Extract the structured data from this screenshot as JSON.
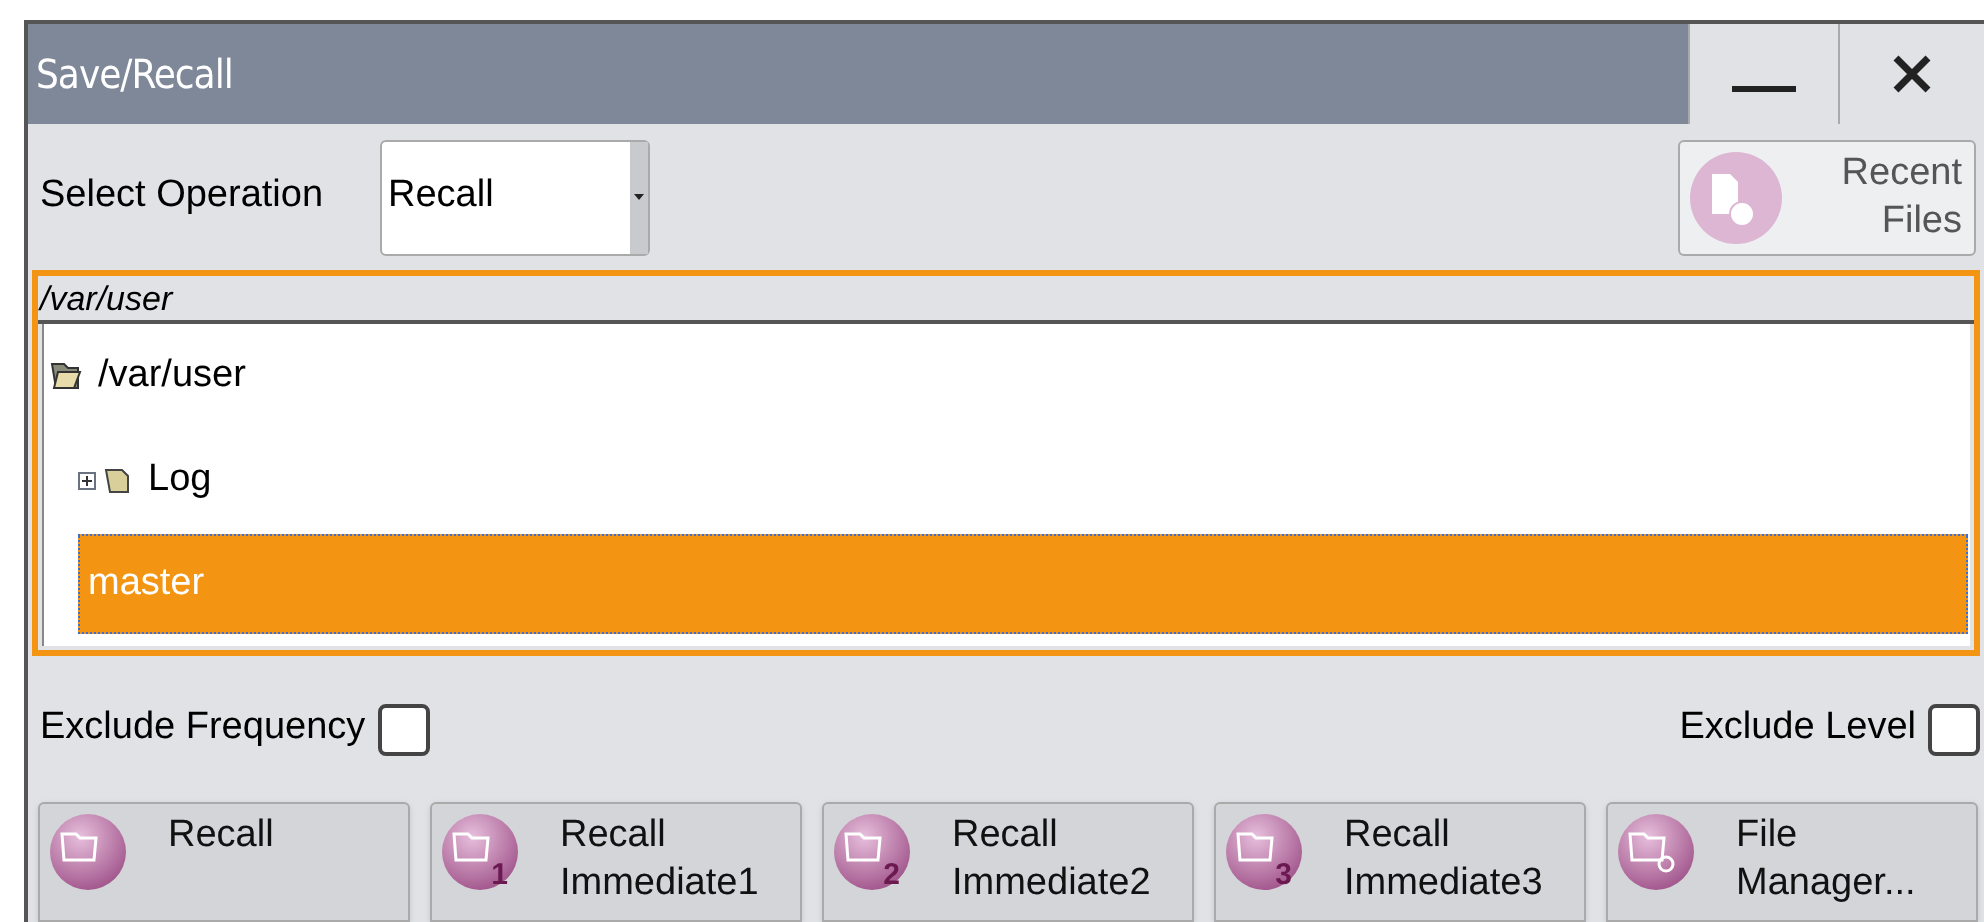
{
  "window": {
    "title": "Save/Recall"
  },
  "operation": {
    "label": "Select Operation",
    "value": "Recall"
  },
  "recent_files": {
    "label": "Recent Files"
  },
  "path_header": "/var/user",
  "tree": [
    {
      "label": "/var/user",
      "kind": "root",
      "selected": false,
      "children": [
        {
          "label": "Log",
          "kind": "folder",
          "expanded": false,
          "selected": false
        },
        {
          "label": "master",
          "kind": "file",
          "selected": true
        }
      ]
    }
  ],
  "options": [
    {
      "label": "Exclude Frequency",
      "checked": false
    },
    {
      "label": "Exclude Level",
      "checked": false
    }
  ],
  "buttons": [
    {
      "label": "Recall",
      "kind": "open"
    },
    {
      "label": "Recall Immediate1",
      "kind": "open",
      "badge": "1"
    },
    {
      "label": "Recall Immediate2",
      "kind": "open",
      "badge": "2"
    },
    {
      "label": "Recall Immediate3",
      "kind": "open",
      "badge": "3"
    },
    {
      "label": "File Manager...",
      "kind": "search"
    }
  ]
}
